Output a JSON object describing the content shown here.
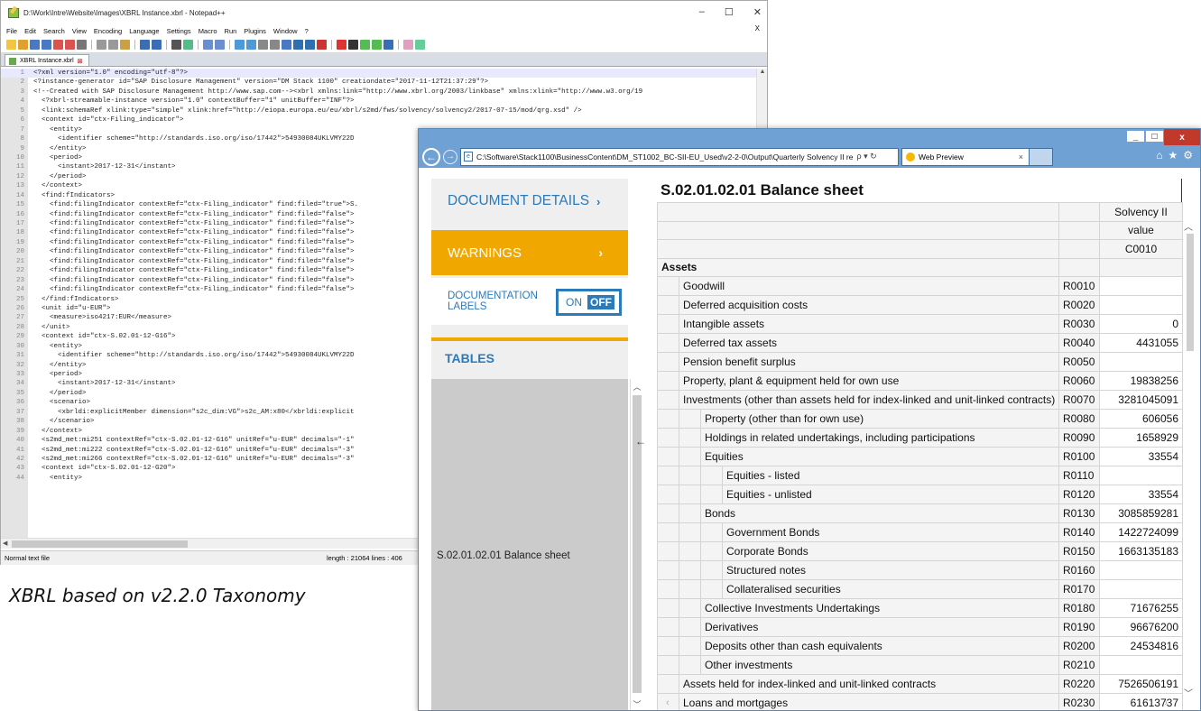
{
  "npp": {
    "title": "D:\\Work\\Intre\\Website\\Images\\XBRL Instance.xbrl - Notepad++",
    "window_controls": [
      "–",
      "☐",
      "✕"
    ],
    "menu": [
      "File",
      "Edit",
      "Search",
      "View",
      "Encoding",
      "Language",
      "Settings",
      "Macro",
      "Run",
      "Plugins",
      "Window",
      "?"
    ],
    "menu_close": "X",
    "tab_label": "XBRL Instance.xbrl",
    "status_left": "Normal text file",
    "status_right": "length : 21064    lines : 406",
    "lines": [
      {
        "n": "1",
        "t": "<?xml version=\"1.0\" encoding=\"utf-8\"?>"
      },
      {
        "n": "2",
        "t": "<?instance-generator id=\"SAP Disclosure Management\" version=\"DM Stack 1100\" creationdate=\"2017-11-12T21:37:29\"?>"
      },
      {
        "n": "3",
        "t": "<!--Created with SAP Disclosure Management http://www.sap.com--><xbrl xmlns:link=\"http://www.xbrl.org/2003/linkbase\" xmlns:xlink=\"http://www.w3.org/19"
      },
      {
        "n": "4",
        "t": "  <?xbrl-streamable-instance version=\"1.0\" contextBuffer=\"1\" unitBuffer=\"INF\"?>"
      },
      {
        "n": "5",
        "t": "  <link:schemaRef xlink:type=\"simple\" xlink:href=\"http://eiopa.europa.eu/eu/xbrl/s2md/fws/solvency/solvency2/2017-07-15/mod/qrg.xsd\" />"
      },
      {
        "n": "6",
        "t": "  <context id=\"ctx-Filing_indicator\">"
      },
      {
        "n": "7",
        "t": "    <entity>"
      },
      {
        "n": "8",
        "t": "      <identifier scheme=\"http://standards.iso.org/iso/17442\">54930084UKLVMY22D"
      },
      {
        "n": "9",
        "t": "    </entity>"
      },
      {
        "n": "10",
        "t": "    <period>"
      },
      {
        "n": "11",
        "t": "      <instant>2017-12-31</instant>"
      },
      {
        "n": "12",
        "t": "    </period>"
      },
      {
        "n": "13",
        "t": "  </context>"
      },
      {
        "n": "14",
        "t": "  <find:fIndicators>"
      },
      {
        "n": "15",
        "t": "    <find:filingIndicator contextRef=\"ctx-Filing_indicator\" find:filed=\"true\">S."
      },
      {
        "n": "16",
        "t": "    <find:filingIndicator contextRef=\"ctx-Filing_indicator\" find:filed=\"false\">"
      },
      {
        "n": "17",
        "t": "    <find:filingIndicator contextRef=\"ctx-Filing_indicator\" find:filed=\"false\">"
      },
      {
        "n": "18",
        "t": "    <find:filingIndicator contextRef=\"ctx-Filing_indicator\" find:filed=\"false\">"
      },
      {
        "n": "19",
        "t": "    <find:filingIndicator contextRef=\"ctx-Filing_indicator\" find:filed=\"false\">"
      },
      {
        "n": "20",
        "t": "    <find:filingIndicator contextRef=\"ctx-Filing_indicator\" find:filed=\"false\">"
      },
      {
        "n": "21",
        "t": "    <find:filingIndicator contextRef=\"ctx-Filing_indicator\" find:filed=\"false\">"
      },
      {
        "n": "22",
        "t": "    <find:filingIndicator contextRef=\"ctx-Filing_indicator\" find:filed=\"false\">"
      },
      {
        "n": "23",
        "t": "    <find:filingIndicator contextRef=\"ctx-Filing_indicator\" find:filed=\"false\">"
      },
      {
        "n": "24",
        "t": "    <find:filingIndicator contextRef=\"ctx-Filing_indicator\" find:filed=\"false\">"
      },
      {
        "n": "25",
        "t": "  </find:fIndicators>"
      },
      {
        "n": "26",
        "t": "  <unit id=\"u-EUR\">"
      },
      {
        "n": "27",
        "t": "    <measure>iso4217:EUR</measure>"
      },
      {
        "n": "28",
        "t": "  </unit>"
      },
      {
        "n": "29",
        "t": "  <context id=\"ctx-S.02.01-12-G16\">"
      },
      {
        "n": "30",
        "t": "    <entity>"
      },
      {
        "n": "31",
        "t": "      <identifier scheme=\"http://standards.iso.org/iso/17442\">54930084UKLVMY22D"
      },
      {
        "n": "32",
        "t": "    </entity>"
      },
      {
        "n": "33",
        "t": "    <period>"
      },
      {
        "n": "34",
        "t": "      <instant>2017-12-31</instant>"
      },
      {
        "n": "35",
        "t": "    </period>"
      },
      {
        "n": "36",
        "t": "    <scenario>"
      },
      {
        "n": "37",
        "t": "      <xbrldi:explicitMember dimension=\"s2c_dim:VG\">s2c_AM:x80</xbrldi:explicit"
      },
      {
        "n": "38",
        "t": "    </scenario>"
      },
      {
        "n": "39",
        "t": "  </context>"
      },
      {
        "n": "40",
        "t": "  <s2md_met:mi251 contextRef=\"ctx-S.02.01-12-G16\" unitRef=\"u-EUR\" decimals=\"-1\""
      },
      {
        "n": "41",
        "t": "  <s2md_met:mi222 contextRef=\"ctx-S.02.01-12-G16\" unitRef=\"u-EUR\" decimals=\"-3\""
      },
      {
        "n": "42",
        "t": "  <s2md_met:mi266 contextRef=\"ctx-S.02.01-12-G16\" unitRef=\"u-EUR\" decimals=\"-3\""
      },
      {
        "n": "43",
        "t": "  <context id=\"ctx-S.02.01-12-G20\">"
      },
      {
        "n": "44",
        "t": "    <entity>"
      }
    ]
  },
  "caption": "XBRL based on v2.2.0 Taxonomy",
  "ie": {
    "address": "C:\\Software\\Stack1100\\BusinessContent\\DM_ST1002_BC-SII-EU_Used\\v2-2-0\\Output\\Quarterly Solvency II re",
    "address_controls": "ρ ▾ ↻",
    "tab_title": "Web Preview",
    "tab_close": "×",
    "window_controls": {
      "min": "_",
      "max": "□",
      "close": "x"
    },
    "toolbar_icons": [
      "home-icon",
      "star-icon",
      "gear-icon"
    ]
  },
  "sidebar": {
    "document_details": "DOCUMENT DETAILS",
    "warnings": "WARNINGS",
    "doc_labels_line1": "DOCUMENTATION",
    "doc_labels_line2": "LABELS",
    "toggle_on": "ON",
    "toggle_off": "OFF",
    "tables": "TABLES",
    "table_item": "S.02.01.02.01 Balance sheet",
    "collapse_arrow": "←"
  },
  "report": {
    "title": "S.02.01.02.01 Balance sheet",
    "col_header_1": "Solvency II",
    "col_header_2": "value",
    "col_code": "C0010",
    "section": "Assets",
    "rows": [
      {
        "label": "Goodwill",
        "level": 1,
        "code": "R0010",
        "value": ""
      },
      {
        "label": "Deferred acquisition costs",
        "level": 1,
        "code": "R0020",
        "value": ""
      },
      {
        "label": "Intangible assets",
        "level": 1,
        "code": "R0030",
        "value": "0"
      },
      {
        "label": "Deferred tax assets",
        "level": 1,
        "code": "R0040",
        "value": "4431055"
      },
      {
        "label": "Pension benefit surplus",
        "level": 1,
        "code": "R0050",
        "value": ""
      },
      {
        "label": "Property, plant & equipment held for own use",
        "level": 1,
        "code": "R0060",
        "value": "19838256"
      },
      {
        "label": "Investments (other than assets held for index-linked and unit-linked contracts)",
        "level": 1,
        "code": "R0070",
        "value": "3281045091"
      },
      {
        "label": "Property (other than for own use)",
        "level": 2,
        "code": "R0080",
        "value": "606056"
      },
      {
        "label": "Holdings in related undertakings, including participations",
        "level": 2,
        "code": "R0090",
        "value": "1658929"
      },
      {
        "label": "Equities",
        "level": 2,
        "code": "R0100",
        "value": "33554"
      },
      {
        "label": "Equities - listed",
        "level": 3,
        "code": "R0110",
        "value": ""
      },
      {
        "label": "Equities - unlisted",
        "level": 3,
        "code": "R0120",
        "value": "33554"
      },
      {
        "label": "Bonds",
        "level": 2,
        "code": "R0130",
        "value": "3085859281"
      },
      {
        "label": "Government Bonds",
        "level": 3,
        "code": "R0140",
        "value": "1422724099"
      },
      {
        "label": "Corporate Bonds",
        "level": 3,
        "code": "R0150",
        "value": "1663135183"
      },
      {
        "label": "Structured notes",
        "level": 3,
        "code": "R0160",
        "value": ""
      },
      {
        "label": "Collateralised securities",
        "level": 3,
        "code": "R0170",
        "value": ""
      },
      {
        "label": "Collective Investments Undertakings",
        "level": 2,
        "code": "R0180",
        "value": "71676255"
      },
      {
        "label": "Derivatives",
        "level": 2,
        "code": "R0190",
        "value": "96676200"
      },
      {
        "label": "Deposits other than cash equivalents",
        "level": 2,
        "code": "R0200",
        "value": "24534816"
      },
      {
        "label": "Other investments",
        "level": 2,
        "code": "R0210",
        "value": ""
      },
      {
        "label": "Assets held for index-linked and unit-linked contracts",
        "level": 1,
        "code": "R0220",
        "value": "7526506191"
      },
      {
        "label": "Loans and mortgages",
        "level": 1,
        "code": "R0230",
        "value": "61613737"
      }
    ]
  },
  "colors": {
    "accent_blue": "#2b7ab9",
    "warning_orange": "#f0a800",
    "ie_chrome": "#6fa1d4"
  }
}
